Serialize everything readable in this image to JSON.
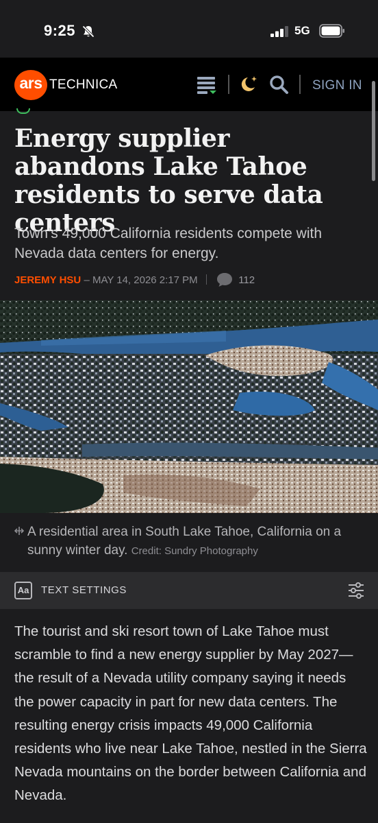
{
  "status_bar": {
    "time": "9:25",
    "network": "5G",
    "icons": [
      "bell-slash-icon",
      "signal-bars-icon",
      "battery-icon"
    ]
  },
  "site_header": {
    "logo_ars": "ars",
    "logo_technica": "TECHNICA",
    "sign_in": "SIGN IN",
    "icons": [
      "menu-icon",
      "moon-icon",
      "search-icon"
    ],
    "brand_color": "#ff4e00"
  },
  "article": {
    "headline": "Energy supplier abandons Lake Tahoe residents to serve data centers",
    "dek": "Town’s 49,000 California residents compete with Nevada data centers for energy.",
    "author": "JEREMY HSU",
    "date": "MAY 14, 2026 2:17 PM",
    "comment_count": "112",
    "caption": "A residential area in South Lake Tahoe, California on a sunny winter day.",
    "credit": "Credit: Sundry Photography",
    "body": "The tourist and ski resort town of Lake Tahoe must scramble to find a new energy supplier by May 2027—the result of a Nevada utility company saying it needs the power capacity in part for new data centers. The resulting energy crisis impacts 49,000 California residents who live near Lake Tahoe, nestled in the Sierra Nevada mountains on the border between California and Nevada."
  },
  "text_settings": {
    "aa": "Aa",
    "label": "TEXT SETTINGS"
  }
}
